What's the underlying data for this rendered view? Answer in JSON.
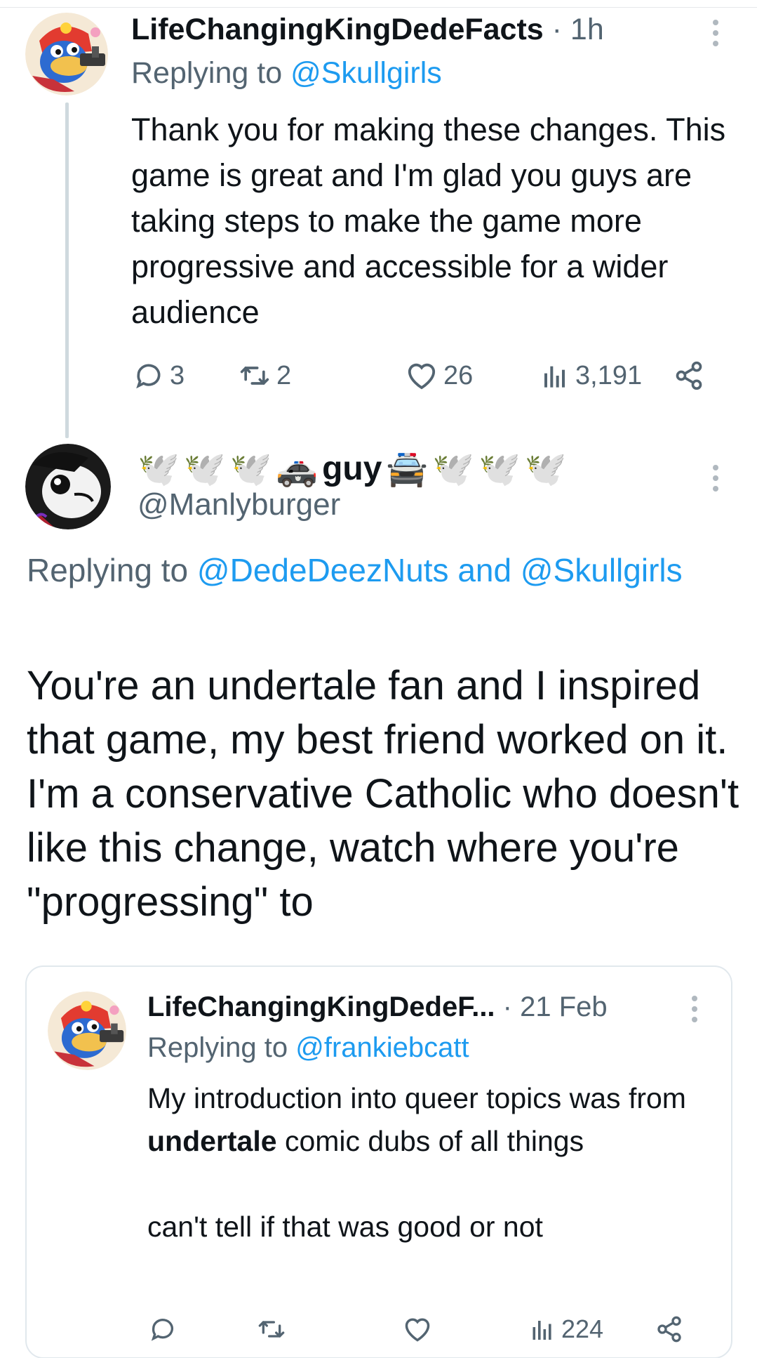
{
  "tweet1": {
    "display_name": "LifeChangingKingDedeFacts",
    "time": "· 1h",
    "replying_prefix": "Replying to",
    "replying_handle": "@Skullgirls",
    "text": "Thank you for making these changes. This game is great and I'm glad you guys are taking steps to make the game more progressive and accessible for a wider audience",
    "stats": {
      "replies": "3",
      "reposts": "2",
      "likes": "26",
      "views": "3,191"
    }
  },
  "tweet2": {
    "display_name": "guy",
    "handle": "@Manlyburger",
    "replying_prefix": "Replying to",
    "replying_handles": "@DedeDeezNuts and @Skullgirls",
    "text": "You're an undertale fan and I inspired that game, my best friend worked on it. I'm a conservative Catholic who doesn't like this change, watch where you're \"progressing\" to"
  },
  "quoted": {
    "display_name": "LifeChangingKingDedeF...",
    "time": "· 21 Feb",
    "replying_prefix": "Replying to",
    "replying_handle": "@frankiebcatt",
    "text_before": "My introduction into queer topics was from ",
    "text_bold": "undertale",
    "text_after": " comic dubs of all things",
    "text_second": "can't tell if that was good or not",
    "stats": {
      "views": "224"
    }
  },
  "colors": {
    "link": "#1d9bf0",
    "muted": "#536471",
    "text": "#0f1419",
    "thread_line": "#cfd9de"
  }
}
